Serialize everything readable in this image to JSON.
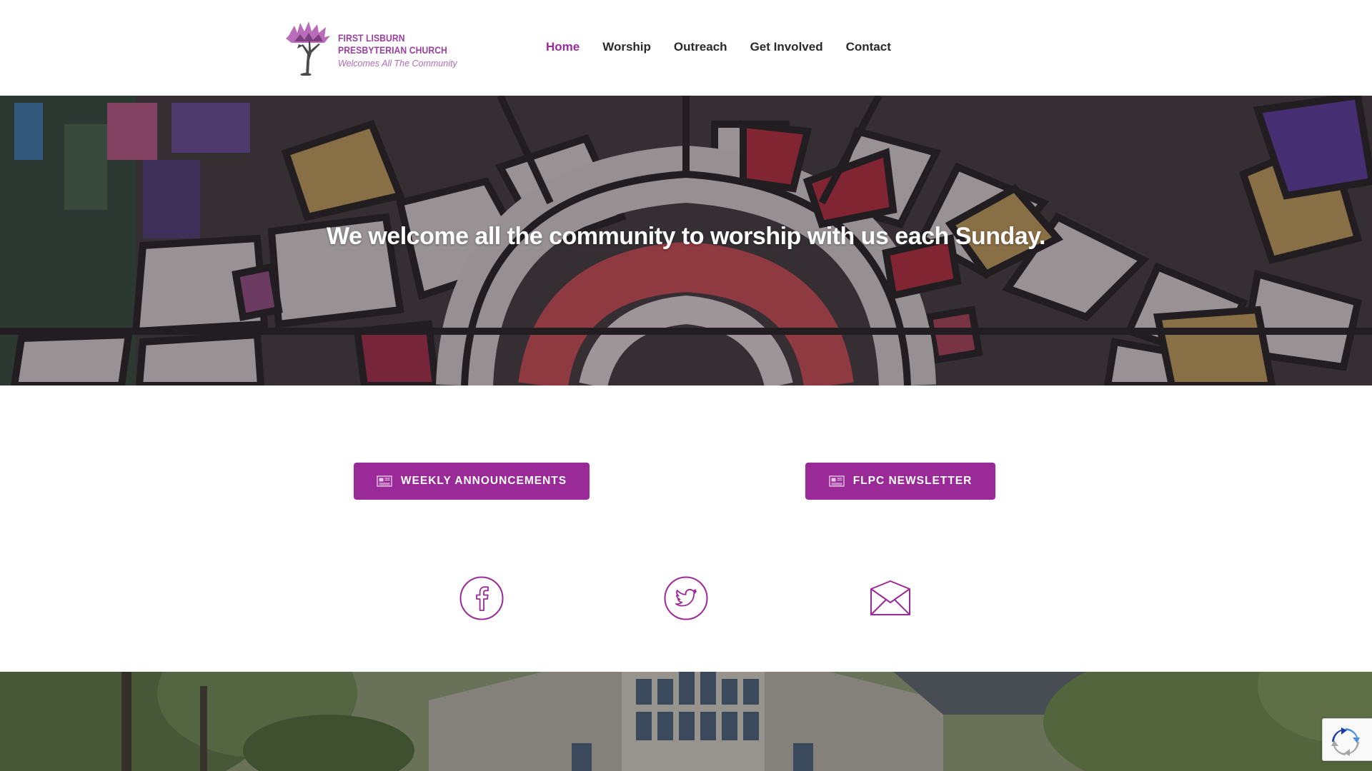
{
  "header": {
    "logo": {
      "line1": "FIRST LISBURN",
      "line2": "PRESBYTERIAN CHURCH",
      "tagline": "Welcomes All The Community",
      "icon": "tree-logo-icon"
    },
    "nav": [
      {
        "label": "Home",
        "active": true
      },
      {
        "label": "Worship",
        "active": false
      },
      {
        "label": "Outreach",
        "active": false
      },
      {
        "label": "Get Involved",
        "active": false
      },
      {
        "label": "Contact",
        "active": false
      }
    ]
  },
  "hero": {
    "heading": "We welcome all the community to worship with us each Sunday."
  },
  "buttons": {
    "announcements": {
      "label": "WEEKLY ANNOUNCEMENTS",
      "icon": "newspaper-icon"
    },
    "newsletter": {
      "label": "FLPC NEWSLETTER",
      "icon": "newspaper-icon"
    }
  },
  "social": [
    {
      "name": "facebook",
      "icon": "facebook-icon"
    },
    {
      "name": "twitter",
      "icon": "twitter-icon"
    },
    {
      "name": "email",
      "icon": "envelope-icon"
    }
  ],
  "recaptcha": {
    "icon": "recaptcha-icon"
  },
  "colors": {
    "brand_purple": "#9a2a98",
    "nav_active": "#9b2c9c",
    "nav_text": "#2a2a2a",
    "logo_purple": "#9b3fa3"
  }
}
